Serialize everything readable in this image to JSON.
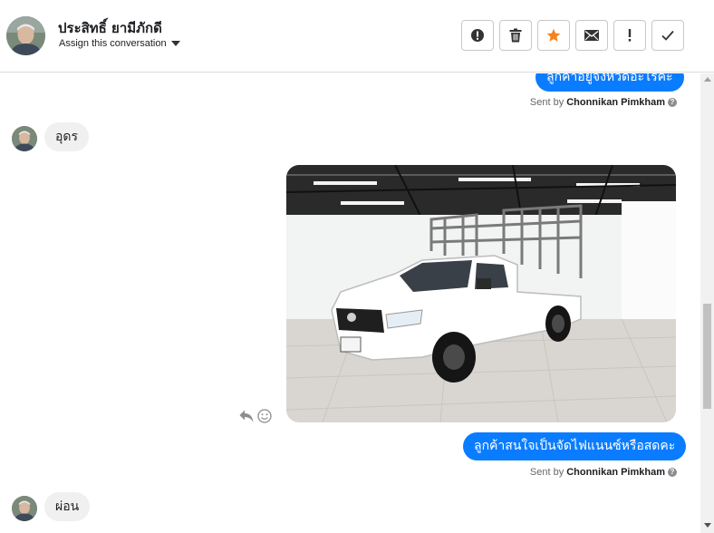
{
  "header": {
    "contact_name": "ประสิทธิ์ ยามีภักดี",
    "assign_label": "Assign this conversation",
    "actions": [
      {
        "name": "alert-circle",
        "icon": "alert-circle-icon"
      },
      {
        "name": "delete",
        "icon": "trash-icon"
      },
      {
        "name": "star",
        "icon": "star-icon",
        "color": "#f5821f"
      },
      {
        "name": "email",
        "icon": "envelope-icon"
      },
      {
        "name": "important",
        "icon": "exclamation-icon"
      },
      {
        "name": "done",
        "icon": "check-icon"
      }
    ]
  },
  "messages": {
    "m1_text": "ลูกค้าอยู่จังหวัดอะไรคะ",
    "m1_sentby_prefix": "Sent by",
    "m1_sentby_name": "Chonnikan Pimkham",
    "m2_text": "อุดร",
    "m3_text": "ลูกค้าสนใจเป็นจัดไฟแนนซ์หรือสดคะ",
    "m3_sentby_prefix": "Sent by",
    "m3_sentby_name": "Chonnikan Pimkham",
    "m4_text": "ผ่อน"
  },
  "colors": {
    "outgoing_bubble": "#0a7cff",
    "incoming_bubble": "#f0f0f0",
    "star_accent": "#f5821f"
  }
}
